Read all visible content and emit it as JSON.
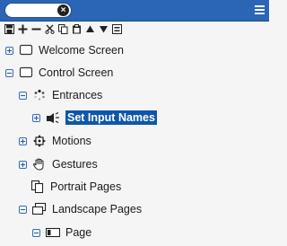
{
  "search": {
    "value": "",
    "placeholder": ""
  },
  "toolbar": {
    "buttons": [
      "save-icon",
      "add-icon",
      "remove-icon",
      "cut-icon",
      "copy-icon",
      "paste-icon",
      "move-up-icon",
      "move-down-icon",
      "properties-icon"
    ]
  },
  "tree": {
    "welcome": "Welcome Screen",
    "control": "Control Screen",
    "entrances": "Entrances",
    "set_input_names": "Set Input Names",
    "motions": "Motions",
    "gestures": "Gestures",
    "portrait": "Portrait Pages",
    "landscape": "Landscape Pages",
    "page": "Page"
  },
  "colors": {
    "header": "#2a65b6",
    "selection": "#0f56a8",
    "background": "#f5f5f5"
  }
}
